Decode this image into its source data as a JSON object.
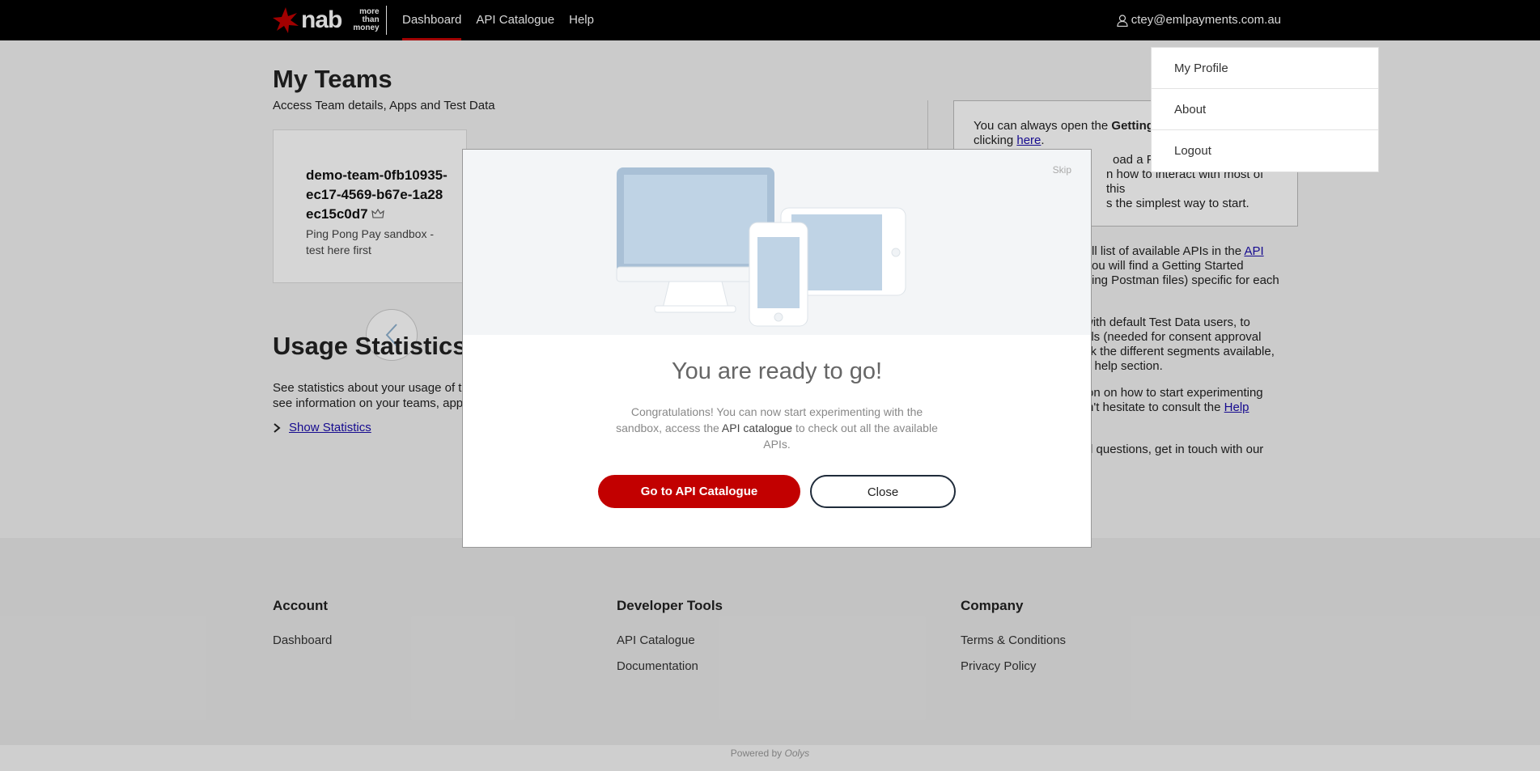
{
  "header": {
    "logo_text": "nab",
    "logo_tagline": [
      "more",
      "than",
      "money"
    ],
    "nav": [
      {
        "label": "Dashboard"
      },
      {
        "label": "API Catalogue"
      },
      {
        "label": "Help"
      }
    ],
    "user_email": "ctey@emlpayments.com.au"
  },
  "user_menu": {
    "items": [
      "My Profile",
      "About",
      "Logout"
    ]
  },
  "teams": {
    "title": "My Teams",
    "subtitle": "Access Team details, Apps and Test Data",
    "card": {
      "name": "demo-team-0fb10935-ec17-4569-b67e-1a28ec15c0d7",
      "owner_icon": "crown-icon",
      "description": "Ping Pong Pay sandbox - test here first"
    }
  },
  "usage": {
    "title": "Usage Statistics",
    "text_line1": "See statistics about your usage of th",
    "text_line2": "see information on your teams, app",
    "show_link": "Show Statistics"
  },
  "help_panel": {
    "line1_pre": "You can always open the ",
    "line1_bold": "Getting",
    "line2_pre": "clicking ",
    "line2_link": "here",
    "line2_post": ".",
    "line3": "oad a Postman collection",
    "line4": "n how to interact with most of this",
    "line5": "s the simplest way to start."
  },
  "right_text": {
    "p1_l1_pre": "ll list of available APIs in the ",
    "p1_l1_link": "API",
    "p1_l2": "ou will find a Getting Started",
    "p1_l3": "ing Postman files) specific for each",
    "p2_l1": "with default Test Data users, to",
    "p2_l2": "als (needed for consent approval",
    "p2_l3": "ck the different segments available,",
    "p2_l4_link": "a",
    "p2_l4_post": " help section.",
    "p3_l1": "on on how to start experimenting",
    "p3_l2_pre": "n't hesitate to consult the ",
    "p3_l2_link": "Help",
    "p4_l1": "d questions, get in touch with our"
  },
  "modal": {
    "skip": "Skip",
    "title": "You are ready to go!",
    "text_pre": "Congratulations! You can now start experimenting with the sandbox, access the ",
    "text_link": "API catalogue",
    "text_post": " to check out all the available APIs.",
    "primary_button": "Go to API Catalogue",
    "secondary_button": "Close"
  },
  "footer": {
    "columns": [
      {
        "title": "Account",
        "links": [
          "Dashboard"
        ]
      },
      {
        "title": "Developer Tools",
        "links": [
          "API Catalogue",
          "Documentation"
        ]
      },
      {
        "title": "Company",
        "links": [
          "Terms & Conditions",
          "Privacy Policy"
        ]
      }
    ],
    "powered_by_pre": "Powered by ",
    "powered_by_brand": "Oolys"
  },
  "colors": {
    "brand_red": "#c20000",
    "header_bg": "#000000",
    "link": "#1a0dab"
  }
}
